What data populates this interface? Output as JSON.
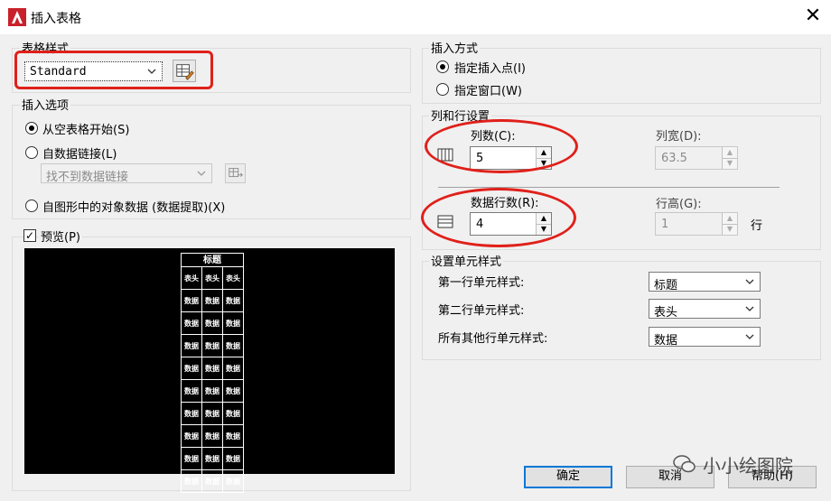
{
  "window": {
    "title": "插入表格",
    "close_glyph": "✕"
  },
  "table_style": {
    "group_label": "表格样式",
    "selected": "Standard"
  },
  "insert_options": {
    "group_label": "插入选项",
    "from_empty": "从空表格开始(S)",
    "from_data_link": "自数据链接(L)",
    "data_link_value": "找不到数据链接",
    "from_object_data": "自图形中的对象数据 (数据提取)(X)"
  },
  "preview": {
    "label": "预览(P)",
    "title_cell": "标题",
    "header_cell": "表头",
    "data_cell": "数据"
  },
  "insert_method": {
    "group_label": "插入方式",
    "point": "指定插入点(I)",
    "window": "指定窗口(W)"
  },
  "rows_cols": {
    "group_label": "列和行设置",
    "columns_label": "列数(C):",
    "columns_value": "5",
    "col_width_label": "列宽(D):",
    "col_width_value": "63.5",
    "data_rows_label": "数据行数(R):",
    "data_rows_value": "4",
    "row_height_label": "行高(G):",
    "row_height_value": "1",
    "row_unit": "行"
  },
  "cell_styles": {
    "group_label": "设置单元样式",
    "first_row_label": "第一行单元样式:",
    "first_row_value": "标题",
    "second_row_label": "第二行单元样式:",
    "second_row_value": "表头",
    "other_rows_label": "所有其他行单元样式:",
    "other_rows_value": "数据"
  },
  "buttons": {
    "ok": "确定",
    "cancel": "取消",
    "help": "帮助(H)"
  },
  "watermark": "小小绘图院",
  "colors": {
    "highlight_red": "#e0201a",
    "accent_blue": "#0078d7"
  }
}
